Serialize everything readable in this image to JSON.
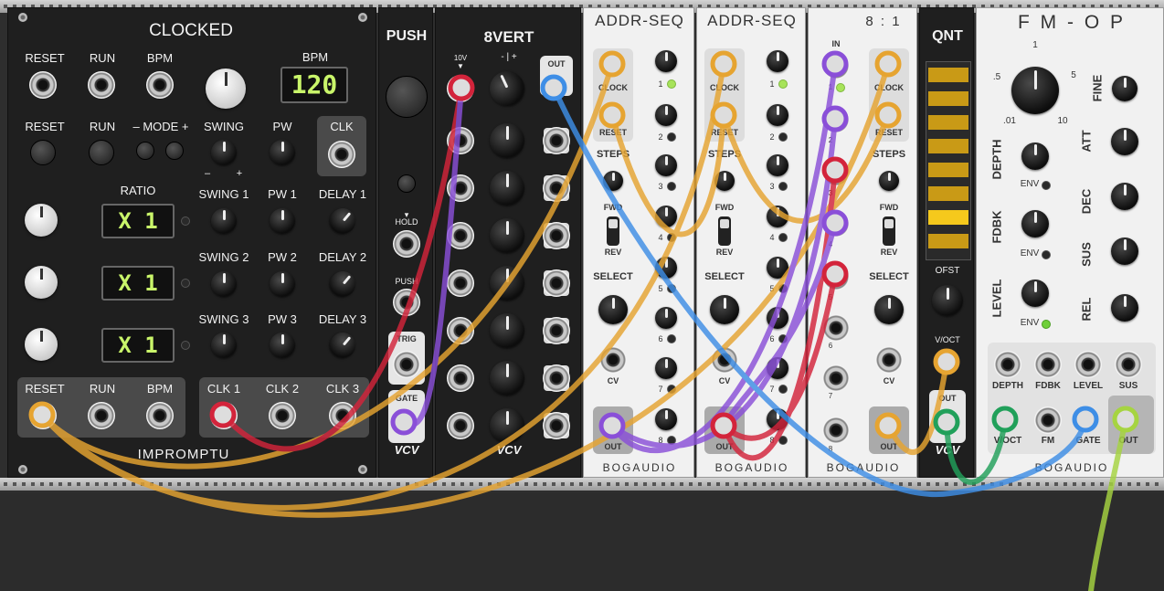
{
  "clocked": {
    "title": "CLOCKED",
    "labels_row1": [
      "RESET",
      "RUN",
      "BPM"
    ],
    "bpm_label": "BPM",
    "bpm_display": "120",
    "labels_row2": [
      "RESET",
      "RUN",
      "– MODE +",
      "SWING",
      "PW"
    ],
    "clk_label": "CLK",
    "swing_minus": "–",
    "swing_plus": "+",
    "ratio_label": "RATIO",
    "ratio_displays": [
      "X 1",
      "X 1",
      "X 1"
    ],
    "channel_labels": [
      [
        "SWING 1",
        "PW 1",
        "DELAY 1"
      ],
      [
        "SWING 2",
        "PW 2",
        "DELAY 2"
      ],
      [
        "SWING 3",
        "PW 3",
        "DELAY 3"
      ]
    ],
    "out_left_labels": [
      "RESET",
      "RUN",
      "BPM"
    ],
    "out_right_labels": [
      "CLK 1",
      "CLK 2",
      "CLK 3"
    ],
    "brand": "IMPROMPTU"
  },
  "push": {
    "title": "PUSH",
    "hold_label": "HOLD",
    "push_label": "PUSH",
    "trig_label": "TRIG",
    "gate_label": "GATE",
    "brand": "VCV"
  },
  "eightvert": {
    "title": "8VERT",
    "range_label": "10V",
    "sign_label": "- | +",
    "out_label": "OUT",
    "brand": "VCV"
  },
  "addrseq": [
    {
      "title": "ADDR-SEQ",
      "clock_label": "CLOCK",
      "reset_label": "RESET",
      "steps_label": "STEPS",
      "fwd_label": "FWD",
      "rev_label": "REV",
      "select_label": "SELECT",
      "cv_label": "CV",
      "out_label": "OUT",
      "brand": "BOGAUDIO",
      "step_numbers": [
        "1",
        "2",
        "3",
        "4",
        "5",
        "6",
        "7",
        "8"
      ]
    },
    {
      "title": "ADDR-SEQ",
      "clock_label": "CLOCK",
      "reset_label": "RESET",
      "steps_label": "STEPS",
      "fwd_label": "FWD",
      "rev_label": "REV",
      "select_label": "SELECT",
      "cv_label": "CV",
      "out_label": "OUT",
      "brand": "BOGAUDIO",
      "step_numbers": [
        "1",
        "2",
        "3",
        "4",
        "5",
        "6",
        "7",
        "8"
      ]
    }
  ],
  "eight_to_one": {
    "title": "8 : 1",
    "in_label": "IN",
    "clock_label": "CLOCK",
    "reset_label": "RESET",
    "steps_label": "STEPS",
    "fwd_label": "FWD",
    "rev_label": "REV",
    "select_label": "SELECT",
    "cv_label": "CV",
    "out_label": "OUT",
    "brand": "BOGAUDIO",
    "in_numbers": [
      "1",
      "2",
      "3",
      "4",
      "5",
      "6",
      "7",
      "8"
    ]
  },
  "qnt": {
    "title": "QNT",
    "ofst_label": "OFST",
    "voct_label": "V/OCT",
    "out_label": "OUT",
    "brand": "VCV"
  },
  "fmop": {
    "title": "F M - O P",
    "ratio_scale": [
      ".5",
      "1",
      "5",
      ".01",
      "10"
    ],
    "fine_label": "FINE",
    "depth_label": "DEPTH",
    "fdbk_label": "FDBK",
    "level_label": "LEVEL",
    "env_label": "ENV",
    "att_label": "ATT",
    "dec_label": "DEC",
    "sus_label": "SUS",
    "rel_label": "REL",
    "jack_labels_top": [
      "DEPTH",
      "FDBK",
      "LEVEL",
      "SUS"
    ],
    "jack_labels_bottom": [
      "V/OCT",
      "FM",
      "GATE",
      "OUT"
    ],
    "brand": "BOGAUDIO"
  },
  "colors": {
    "cable_orange": "#e6a431",
    "cable_red": "#d3243b",
    "cable_blue": "#3e8ee6",
    "cable_purple": "#8a4fd8",
    "cable_green": "#21a05a",
    "cable_lime": "#a6d441",
    "lcd_green": "#c9f56a"
  }
}
